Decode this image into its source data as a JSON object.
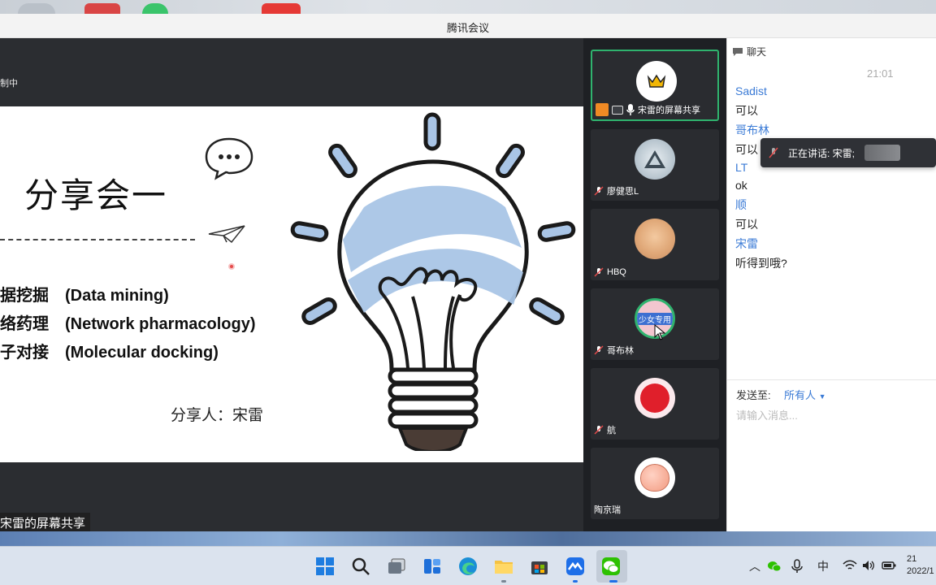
{
  "window": {
    "title": "腾讯会议"
  },
  "share": {
    "record_status": "制中",
    "share_label": "宋雷的屏幕共享"
  },
  "slide": {
    "title": "分享会一",
    "topics": [
      "据挖掘　(Data mining)",
      "络药理　(Network pharmacology)",
      "子对接　(Molecular docking)"
    ],
    "presenter": "分享人：宋雷"
  },
  "participants": [
    {
      "name": "宋雷的屏幕共享",
      "avatar": "crown-icon",
      "active": true
    },
    {
      "name": "廖健思L",
      "avatar": "mountain-icon"
    },
    {
      "name": "HBQ",
      "avatar": "baby-photo"
    },
    {
      "name": "哥布林",
      "avatar": "girl-avatar",
      "overlay": "少女专用"
    },
    {
      "name": "航",
      "avatar": "red-monster"
    },
    {
      "name": "陶京瑞",
      "avatar": "peach-icon"
    }
  ],
  "chat": {
    "header": "聊天",
    "time": "21:01",
    "messages": [
      {
        "name": "Sadist",
        "text": "可以"
      },
      {
        "name": "哥布林",
        "text": "可以"
      },
      {
        "name": "LT",
        "text": "ok"
      },
      {
        "name": "顺",
        "text": "可以"
      },
      {
        "name": "宋雷",
        "text": "听得到哦?"
      }
    ],
    "send_to_label": "发送至:",
    "send_to_value": "所有人",
    "input_placeholder": "请输入消息..."
  },
  "speaking_indicator": "正在讲话: 宋雷;",
  "taskbar": {
    "ime": "中",
    "clock_time": "21",
    "clock_date": "2022/1"
  },
  "colors": {
    "accent": "#3b7bd6",
    "active_border": "#2fb36e",
    "bulb_fill": "#a9c5e6"
  }
}
